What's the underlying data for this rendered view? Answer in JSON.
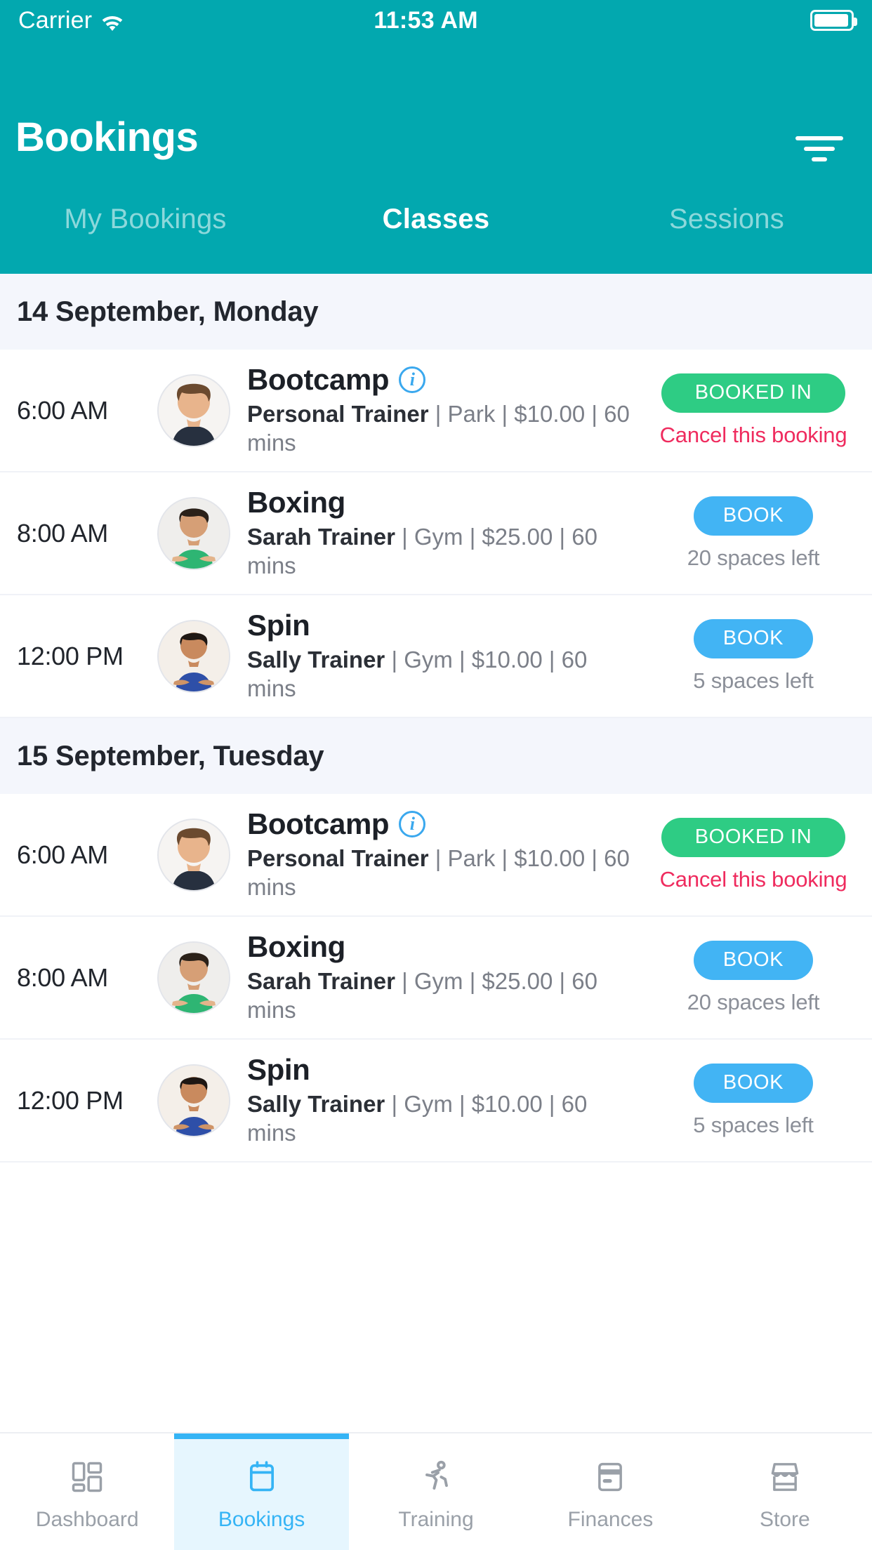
{
  "status_bar": {
    "carrier": "Carrier",
    "wifi_icon": "wifi-icon",
    "time": "11:53 AM",
    "battery_icon": "battery-icon"
  },
  "header": {
    "title": "Bookings",
    "filter_icon": "filter-icon",
    "accent_color": "#02A8AF"
  },
  "segmented_tabs": [
    {
      "label": "My Bookings",
      "active": false
    },
    {
      "label": "Classes",
      "active": true
    },
    {
      "label": "Sessions",
      "active": false
    }
  ],
  "colors": {
    "teal": "#02A8AF",
    "booked_green": "#2ecc84",
    "book_blue": "#42b4f4",
    "cancel_pink": "#ef2b5e",
    "date_header_bg": "#f4f6fc",
    "active_tab_blue": "#35b4f5"
  },
  "sections": [
    {
      "date_label": "14 September, Monday",
      "rows": [
        {
          "time": "6:00 AM",
          "avatar": "avatar-male-trainer",
          "title": "Bootcamp",
          "has_info_icon": true,
          "info_icon": "info-icon",
          "trainer": "Personal Trainer",
          "details": " | Park | $10.00 | 60 mins",
          "action_label": "BOOKED IN",
          "action_type": "booked",
          "note": "Cancel this booking",
          "note_type": "cancel"
        },
        {
          "time": "8:00 AM",
          "avatar": "avatar-female-boxing",
          "title": "Boxing",
          "has_info_icon": false,
          "info_icon": "",
          "trainer": "Sarah Trainer",
          "details": " | Gym | $25.00 | 60 mins",
          "action_label": "BOOK",
          "action_type": "book",
          "note": "20 spaces left",
          "note_type": "spaces"
        },
        {
          "time": "12:00 PM",
          "avatar": "avatar-female-spin",
          "title": "Spin",
          "has_info_icon": false,
          "info_icon": "",
          "trainer": "Sally Trainer",
          "details": " | Gym | $10.00 | 60 mins",
          "action_label": "BOOK",
          "action_type": "book",
          "note": "5 spaces left",
          "note_type": "spaces"
        }
      ]
    },
    {
      "date_label": "15 September, Tuesday",
      "rows": [
        {
          "time": "6:00 AM",
          "avatar": "avatar-male-trainer",
          "title": "Bootcamp",
          "has_info_icon": true,
          "info_icon": "info-icon",
          "trainer": "Personal Trainer",
          "details": " | Park | $10.00 | 60 mins",
          "action_label": "BOOKED IN",
          "action_type": "booked",
          "note": "Cancel this booking",
          "note_type": "cancel"
        },
        {
          "time": "8:00 AM",
          "avatar": "avatar-female-boxing",
          "title": "Boxing",
          "has_info_icon": false,
          "info_icon": "",
          "trainer": "Sarah Trainer",
          "details": " | Gym | $25.00 | 60 mins",
          "action_label": "BOOK",
          "action_type": "book",
          "note": "20 spaces left",
          "note_type": "spaces"
        },
        {
          "time": "12:00 PM",
          "avatar": "avatar-female-spin",
          "title": "Spin",
          "has_info_icon": false,
          "info_icon": "",
          "trainer": "Sally Trainer",
          "details": " | Gym | $10.00 | 60 mins",
          "action_label": "BOOK",
          "action_type": "book",
          "note": "5 spaces left",
          "note_type": "spaces"
        }
      ]
    }
  ],
  "bottom_tabs": [
    {
      "label": "Dashboard",
      "icon": "dashboard-icon",
      "active": false
    },
    {
      "label": "Bookings",
      "icon": "calendar-icon",
      "active": true
    },
    {
      "label": "Training",
      "icon": "running-icon",
      "active": false
    },
    {
      "label": "Finances",
      "icon": "card-icon",
      "active": false
    },
    {
      "label": "Store",
      "icon": "store-icon",
      "active": false
    }
  ]
}
